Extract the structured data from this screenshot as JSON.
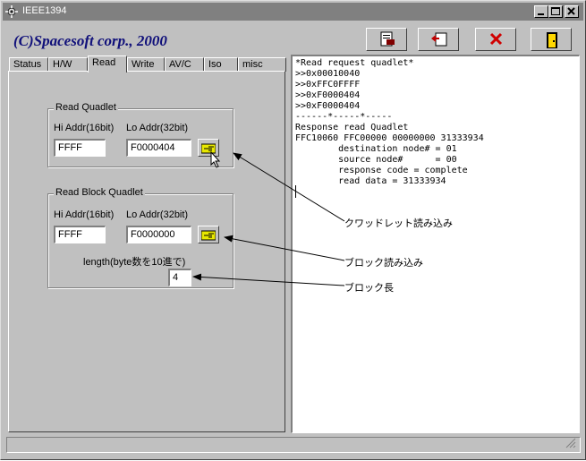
{
  "window": {
    "title": "IEEE1394"
  },
  "brand": "(C)Spacesoft corp., 2000",
  "toolbar": {
    "buttons": [
      {
        "name": "save-log-button",
        "icon": "save-icon"
      },
      {
        "name": "load-button",
        "icon": "load-icon"
      },
      {
        "name": "clear-button",
        "icon": "clear-icon"
      },
      {
        "name": "exit-button",
        "icon": "exit-door-icon"
      }
    ]
  },
  "tabs": [
    "Status",
    "H/W",
    "Read",
    "Write",
    "AV/C",
    "Iso",
    "misc"
  ],
  "active_tab": "Read",
  "read_quadlet": {
    "title": "Read Quadlet",
    "hi_label": "Hi Addr(16bit)",
    "lo_label": "Lo Addr(32bit)",
    "hi_value": "FFFF",
    "lo_value": "F0000404"
  },
  "read_block": {
    "title": "Read Block Quadlet",
    "hi_label": "Hi Addr(16bit)",
    "lo_label": "Lo Addr(32bit)",
    "hi_value": "FFFF",
    "lo_value": "F0000000",
    "length_label": "length(byte数を10進で)",
    "length_value": "4"
  },
  "log": {
    "lines": [
      "*Read request quadlet*",
      ">>0x00010040",
      ">>0xFFC0FFFF",
      ">>0xF0000404",
      ">>0xF0000404",
      "------*-----*-----",
      "Response read Quadlet",
      "FFC10060 FFC00000 00000000 31333934",
      "        destination node# = 01",
      "        source node#      = 00",
      "        response code = complete",
      "        read data = 31333934"
    ]
  },
  "annotations": {
    "quadlet": "クワッドレット読み込み",
    "block": "ブロック読み込み",
    "length": "ブロック長"
  },
  "colors": {
    "brand": "#10107a",
    "titlebar": "#808080",
    "face": "#c0c0c0"
  }
}
